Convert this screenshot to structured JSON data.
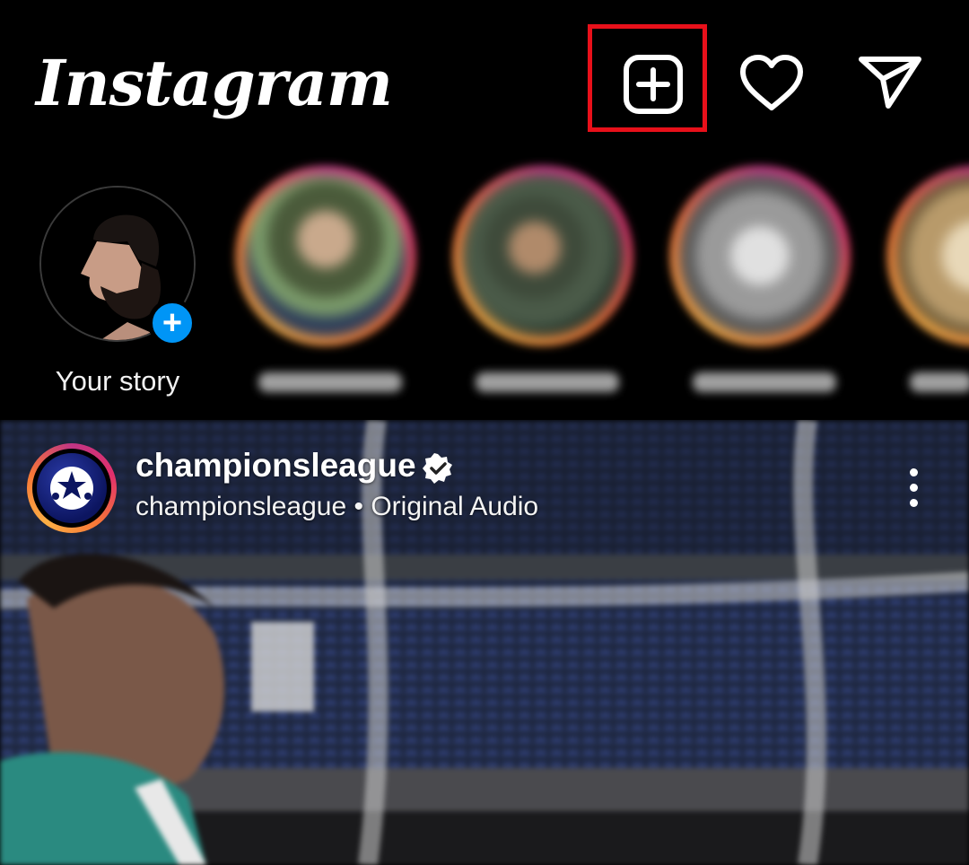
{
  "header": {
    "logo_text": "Instagram",
    "icons": [
      "add-post-icon",
      "heart-icon",
      "send-icon"
    ]
  },
  "stories": {
    "your_story_label": "Your story",
    "items": [
      {
        "name_blurred": true
      },
      {
        "name_blurred": true
      },
      {
        "name_blurred": true
      },
      {
        "name_blurred": true
      }
    ]
  },
  "post": {
    "username": "championsleague",
    "verified": true,
    "subline": "championsleague • Original Audio",
    "menu_icon": "more-vertical-icon"
  },
  "colors": {
    "background": "#000000",
    "highlight": "#e8101a",
    "story_add_badge": "#0095f6"
  }
}
